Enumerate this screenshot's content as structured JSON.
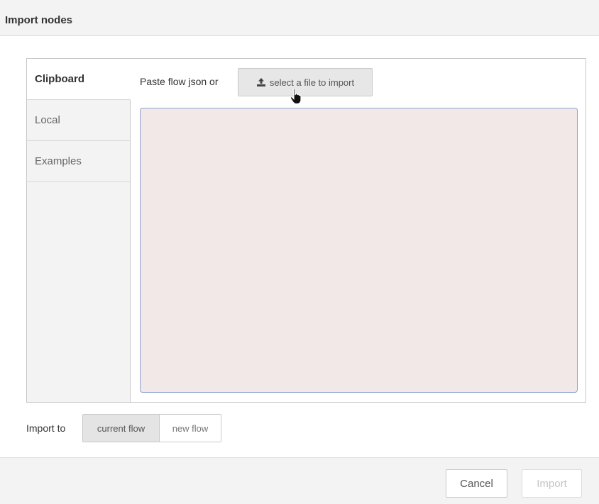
{
  "dialog": {
    "title": "Import nodes"
  },
  "tabs": [
    {
      "label": "Clipboard",
      "active": true
    },
    {
      "label": "Local",
      "active": false
    },
    {
      "label": "Examples",
      "active": false
    }
  ],
  "clipboard": {
    "paste_label": "Paste flow json or",
    "file_button_label": "select a file to import",
    "file_button_icon": "upload-icon",
    "textarea_value": ""
  },
  "import_to": {
    "label": "Import to",
    "options": [
      {
        "label": "current flow",
        "selected": true
      },
      {
        "label": "new flow",
        "selected": false
      }
    ]
  },
  "footer": {
    "cancel_label": "Cancel",
    "import_label": "Import",
    "import_enabled": false
  },
  "colors": {
    "textarea_bg": "#f2e8e8",
    "textarea_border": "#89a3cf",
    "header_bg": "#f3f3f3"
  }
}
